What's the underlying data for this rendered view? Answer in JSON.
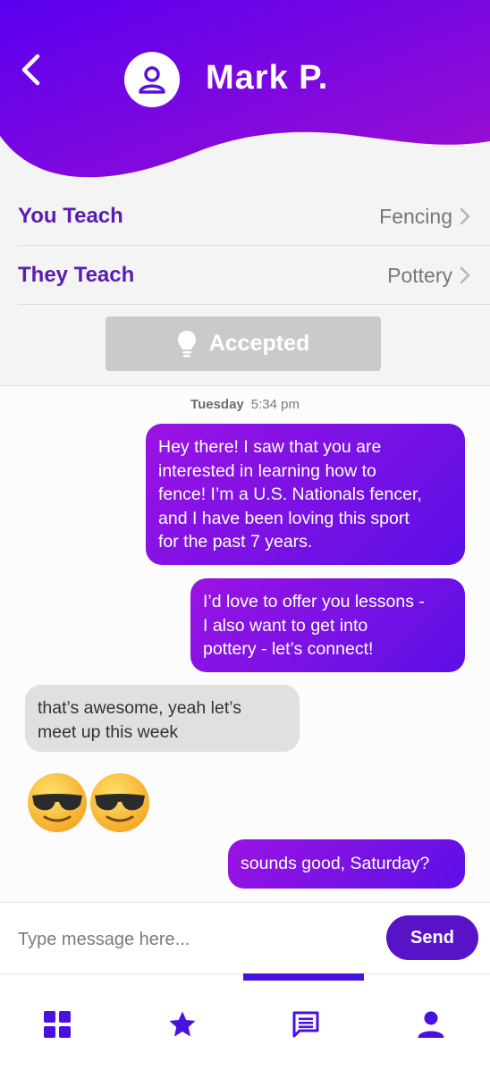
{
  "header": {
    "contact_name": "Mark P.",
    "gradient_start": "#5a00f0",
    "gradient_end": "#9c0fd0",
    "back_icon": "chevron-left-icon",
    "avatar_icon": "person-icon"
  },
  "teaching": {
    "you_teach_label": "You Teach",
    "you_teach_value": "Fencing",
    "they_teach_label": "They Teach",
    "they_teach_value": "Pottery",
    "accent": "#5b1cb0"
  },
  "status_button": {
    "label": "Accepted",
    "icon": "lightbulb-icon"
  },
  "chat": {
    "day": "Tuesday",
    "time": "5:34 pm",
    "messages": [
      {
        "direction": "out",
        "text": "Hey there! I saw that you are\ninterested in learning how to\nfence! I’m a U.S. Nationals fencer,\nand I have been loving this sport\nfor the past 7 years."
      },
      {
        "direction": "out",
        "text": "I’d love to offer you lessons -\nI also want to get into\npottery - let’s connect!"
      },
      {
        "direction": "in",
        "text": "that’s awesome, yeah let’s\nmeet up this week"
      },
      {
        "direction": "in",
        "text": "😎😎",
        "icon": "sunglasses-emoji-icon"
      },
      {
        "direction": "out",
        "text": "sounds good, Saturday?"
      }
    ]
  },
  "composer": {
    "placeholder": "Type message here...",
    "send_label": "Send",
    "send_color": "#5812c8"
  },
  "nav": {
    "active_index": 2,
    "items": [
      {
        "icon": "grid-icon"
      },
      {
        "icon": "star-icon"
      },
      {
        "icon": "chat-icon"
      },
      {
        "icon": "profile-icon"
      }
    ]
  }
}
